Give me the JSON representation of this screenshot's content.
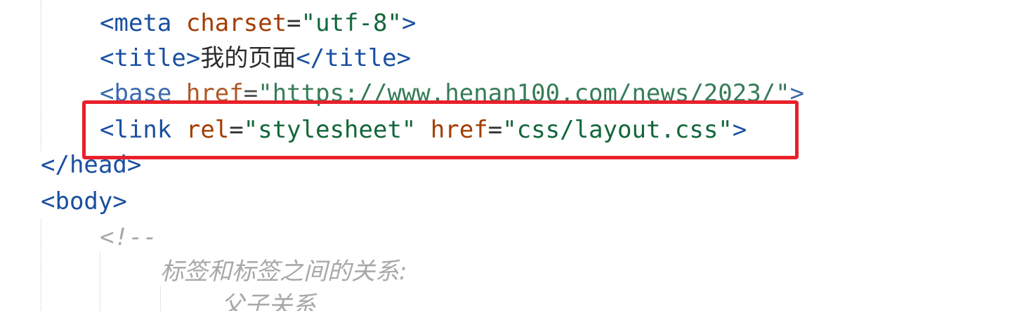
{
  "editor": {
    "lines": {
      "meta": {
        "open": "<",
        "tag": "meta",
        "attr": "charset",
        "eq": "=",
        "value": "\"utf-8\"",
        "close": ">"
      },
      "title": {
        "open": "<",
        "tag": "title",
        "close": ">",
        "text": "我的页面",
        "end_open": "</",
        "end_tag": "title",
        "end_close": ">"
      },
      "base": {
        "open": "<",
        "tag": "base",
        "attr": "href",
        "eq": "=",
        "value": "\"https://www.henan100.com/news/2023/\"",
        "close": ">"
      },
      "link": {
        "open": "<",
        "tag": "link",
        "attr1": "rel",
        "eq1": "=",
        "value1": "\"stylesheet\"",
        "attr2": "href",
        "eq2": "=",
        "value2": "\"css/layout.css\"",
        "close": ">"
      },
      "head_close": {
        "open": "</",
        "tag": "head",
        "close": ">"
      },
      "body_open": {
        "open": "<",
        "tag": "body",
        "close": ">"
      },
      "comment_start": "<!--",
      "comment_line1": "标签和标签之间的关系:",
      "comment_line2": "父子关系"
    },
    "highlight_color": "#e8202a"
  }
}
